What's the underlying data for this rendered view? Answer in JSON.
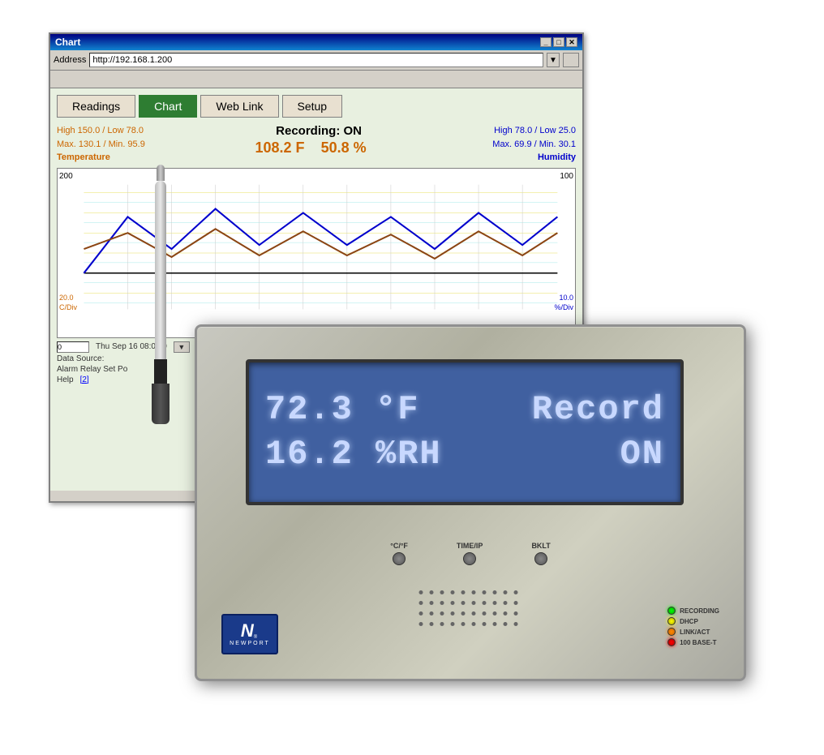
{
  "browser": {
    "title": "Chart",
    "address": "http://192.168.1.200",
    "address_label": "Address",
    "controls": {
      "minimize": "_",
      "maximize": "□",
      "close": "✕"
    }
  },
  "tabs": [
    {
      "id": "readings",
      "label": "Readings",
      "active": false
    },
    {
      "id": "chart",
      "label": "Chart",
      "active": true
    },
    {
      "id": "weblink",
      "label": "Web Link",
      "active": false
    },
    {
      "id": "setup",
      "label": "Setup",
      "active": false
    }
  ],
  "chart": {
    "recording_status": "Recording: ON",
    "temp_high_low": "High 150.0 / Low 78.0",
    "temp_max_min": "Max. 130.1 / Min. 95.9",
    "temp_label": "Temperature",
    "temp_value": "108.2 F",
    "humidity_value": "50.8 %",
    "humidity_label": "Humidity",
    "humidity_high_low": "High 78.0 / Low 25.0",
    "humidity_max_min": "Max. 69.9 / Min. 30.1",
    "y_left": "200",
    "y_right": "100",
    "div_left_val": "20.0",
    "div_left_unit": "C/Div",
    "div_right_val": "10.0",
    "div_right_unit": "%/Div",
    "scroll_value": "0",
    "date_label": "Thu Sep 16 08:00:0",
    "data_source": "Data Source:",
    "alarm_label": "Alarm Relay Set Po",
    "help_text": "Help",
    "help_link": "[2]"
  },
  "lcd": {
    "row1_left": "72.3 °F",
    "row1_right": "Record",
    "row2_left": "16.2 %RH",
    "row2_right": "ON"
  },
  "device_buttons": [
    {
      "label": "°C/°F"
    },
    {
      "label": "TIME/IP"
    },
    {
      "label": "BKLT"
    }
  ],
  "status_leds": [
    {
      "color": "green",
      "label": "RECORDING"
    },
    {
      "color": "yellow",
      "label": "DHCP"
    },
    {
      "color": "orange",
      "label": "LINK/ACT"
    },
    {
      "color": "red",
      "label": "100 BASE-T"
    }
  ],
  "newport": {
    "name": "NEWPORT",
    "reg": "®"
  }
}
